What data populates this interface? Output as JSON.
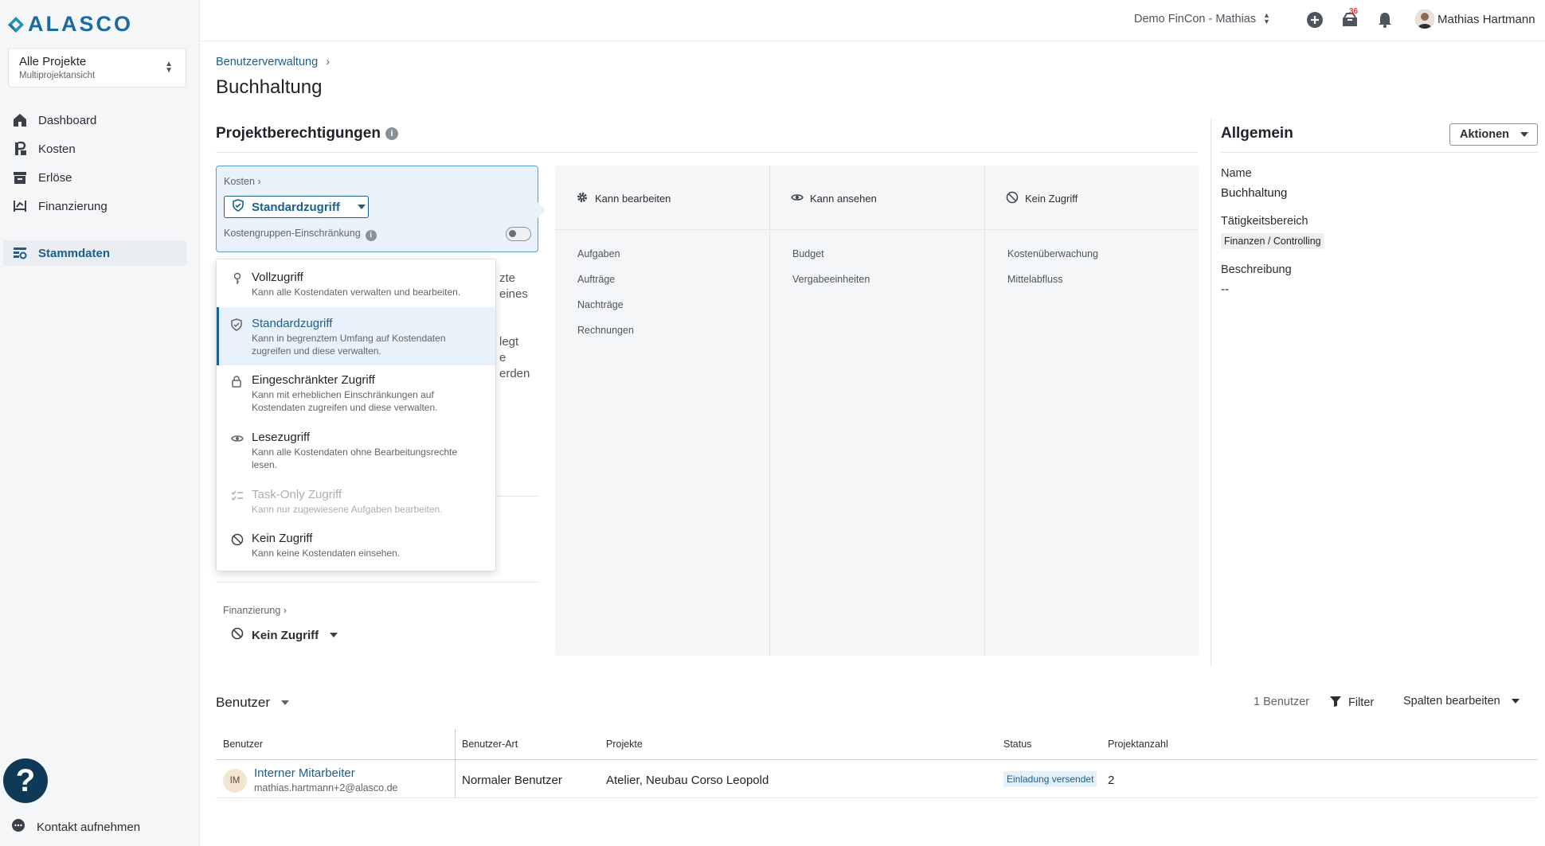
{
  "app": {
    "logo_text": "ALASCO"
  },
  "project_selector": {
    "title": "Alle Projekte",
    "subtitle": "Multiprojektansicht"
  },
  "sidebar": {
    "items": [
      {
        "label": "Dashboard",
        "icon": "home-icon"
      },
      {
        "label": "Kosten",
        "icon": "cost-icon"
      },
      {
        "label": "Erlöse",
        "icon": "revenue-icon"
      },
      {
        "label": "Finanzierung",
        "icon": "financing-icon"
      },
      {
        "label": "Stammdaten",
        "icon": "master-data-icon",
        "active": true
      }
    ],
    "contact": "Kontakt aufnehmen",
    "help": "?"
  },
  "topbar": {
    "org": "Demo FinCon - Mathias",
    "notification_count": "36",
    "user": "Mathias Hartmann"
  },
  "breadcrumb": "Benutzerverwaltung",
  "page_title": "Buchhaltung",
  "permissions": {
    "title": "Projektberechtigungen",
    "info": "i",
    "card": {
      "crumb": "Kosten",
      "selected": "Standardzugriff",
      "restriction": "Kostengruppen-Einschränkung"
    },
    "behind_text": [
      "zte",
      "eines",
      "legt",
      "e",
      "erden"
    ],
    "dropdown": [
      {
        "title": "Vollzugriff",
        "desc": "Kann alle Kostendaten verwalten und bearbeiten.",
        "icon": "key-icon"
      },
      {
        "title": "Standardzugriff",
        "desc": "Kann in begrenztem Umfang auf Kostendaten zugreifen und diese verwalten.",
        "icon": "shield-icon",
        "selected": true
      },
      {
        "title": "Eingeschränkter Zugriff",
        "desc": "Kann mit erheblichen Einschränkungen auf Kostendaten zugreifen und diese verwalten.",
        "icon": "lock-icon"
      },
      {
        "title": "Lesezugriff",
        "desc": "Kann alle Kostendaten ohne Bearbeitungsrechte lesen.",
        "icon": "eye-icon"
      },
      {
        "title": "Task-Only Zugriff",
        "desc": "Kann nur zugewiesene Aufgaben bearbeiten.",
        "icon": "checklist-icon",
        "disabled": true
      },
      {
        "title": "Kein Zugriff",
        "desc": "Kann keine Kostendaten einsehen.",
        "icon": "no-access-icon"
      }
    ],
    "financing": {
      "crumb": "Finanzierung",
      "value": "Kein Zugriff"
    },
    "matrix": {
      "columns": [
        {
          "header": "Kann bearbeiten",
          "icon": "gear-icon",
          "items": [
            "Aufgaben",
            "Aufträge",
            "Nachträge",
            "Rechnungen"
          ]
        },
        {
          "header": "Kann ansehen",
          "icon": "eye-icon",
          "items": [
            "Budget",
            "Vergabeeinheiten"
          ]
        },
        {
          "header": "Kein Zugriff",
          "icon": "no-access-icon",
          "items": [
            "Kostenüberwachung",
            "Mittelabfluss"
          ]
        }
      ]
    }
  },
  "general": {
    "title": "Allgemein",
    "actions": "Aktionen",
    "name_label": "Name",
    "name_value": "Buchhaltung",
    "area_label": "Tätigkeitsbereich",
    "area_value": "Finanzen / Controlling",
    "desc_label": "Beschreibung",
    "desc_value": "--"
  },
  "users": {
    "title": "Benutzer",
    "count": "1 Benutzer",
    "filter": "Filter",
    "columns_button": "Spalten bearbeiten",
    "headers": [
      "Benutzer",
      "Benutzer-Art",
      "Projekte",
      "Status",
      "Projektanzahl"
    ],
    "rows": [
      {
        "initials": "IM",
        "name": "Interner Mitarbeiter",
        "email": "mathias.hartmann+2@alasco.de",
        "type": "Normaler Benutzer",
        "projects": "Atelier, Neubau Corso Leopold",
        "status": "Einladung versendet",
        "project_count": "2"
      }
    ]
  },
  "colors": {
    "primary": "#1b5f8c",
    "accent": "#5a9fd4",
    "badge": "#e53935",
    "help": "#0f3a57"
  }
}
